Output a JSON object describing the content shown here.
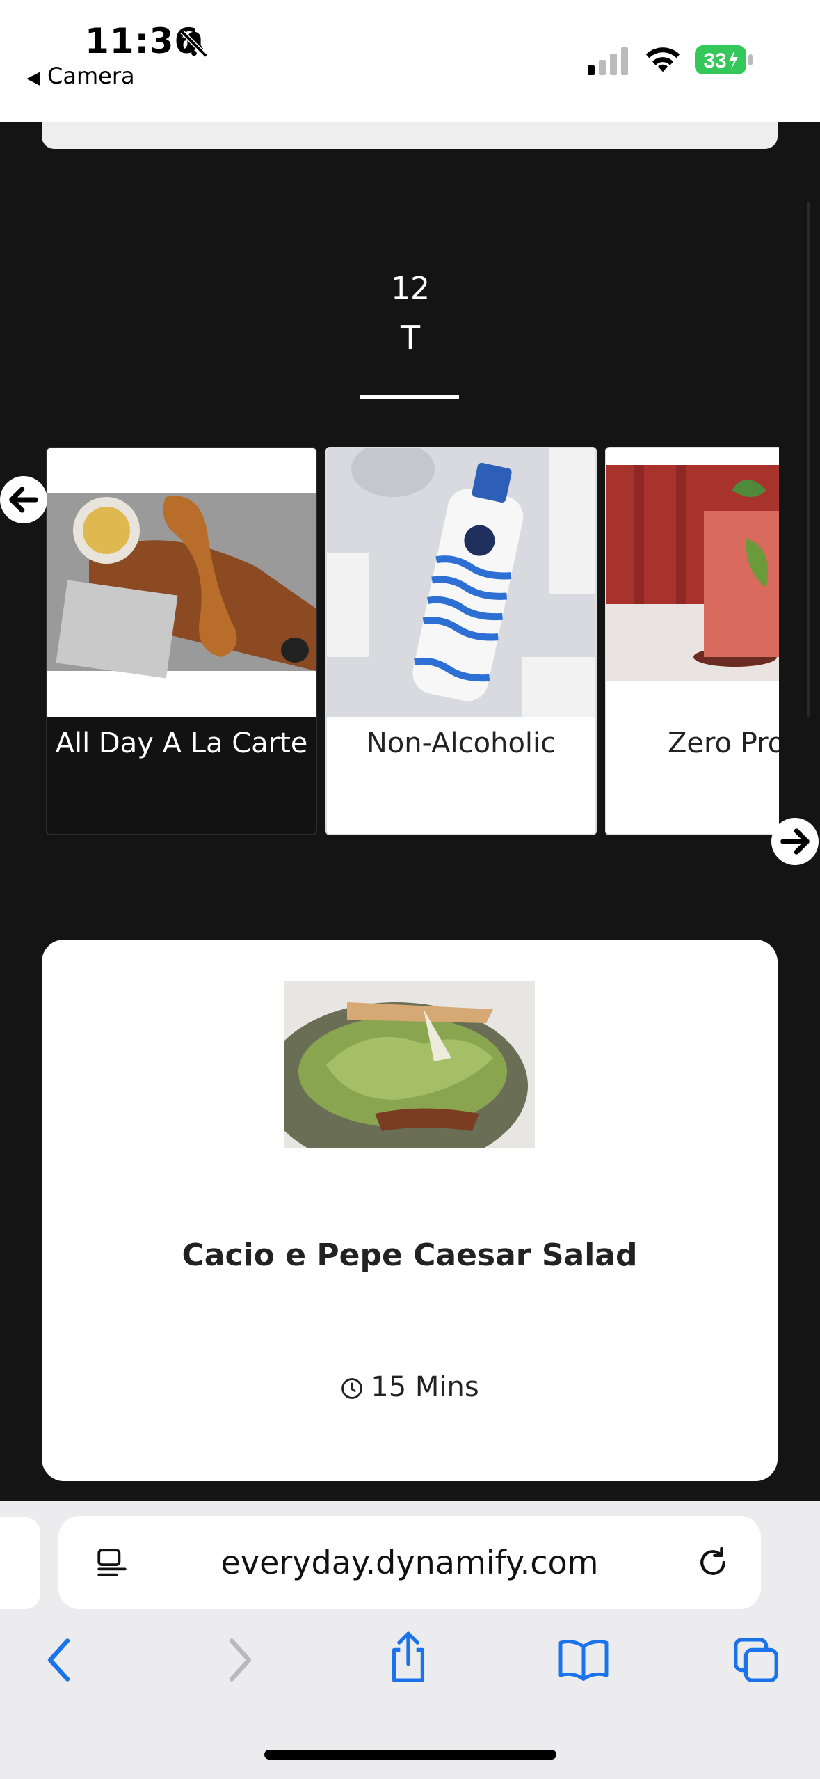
{
  "status_bar": {
    "time": "11:36",
    "back_app_label": "Camera",
    "battery_percent": "33"
  },
  "date": {
    "day": "12",
    "weekday": "T"
  },
  "categories": [
    {
      "label": "All Day A La Carte",
      "selected": true
    },
    {
      "label": "Non-Alcoholic",
      "selected": false
    },
    {
      "label": "Zero Pro",
      "selected": false
    }
  ],
  "menu_item": {
    "title": "Cacio e Pepe Caesar Salad",
    "prep_time": "15 Mins"
  },
  "browser": {
    "url": "everyday.dynamify.com"
  },
  "colors": {
    "page_background": "#141414",
    "card_background": "#ffffff",
    "browser_accent": "#1a73e8",
    "battery_green": "#34c759"
  }
}
